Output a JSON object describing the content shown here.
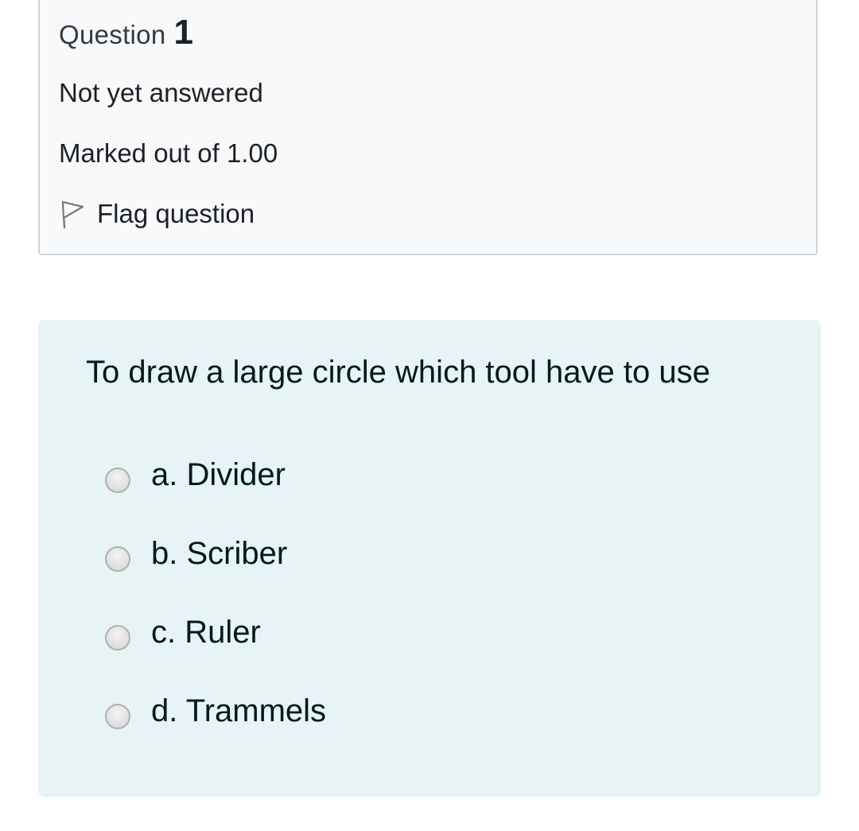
{
  "question_info": {
    "label": "Question",
    "number": "1",
    "state": "Not yet answered",
    "grade": "Marked out of 1.00",
    "flag_label": "Flag question",
    "flag_icon": "flag-icon"
  },
  "question": {
    "text": "To draw a large circle which tool have to use",
    "answers": [
      {
        "label": "a. Divider",
        "selected": false
      },
      {
        "label": "b. Scriber",
        "selected": false
      },
      {
        "label": "c. Ruler",
        "selected": false
      },
      {
        "label": "d. Trammels",
        "selected": false
      }
    ]
  },
  "colors": {
    "info_background": "#f8f9fa",
    "content_background": "#e7f3f5",
    "text": "#1d2125"
  }
}
